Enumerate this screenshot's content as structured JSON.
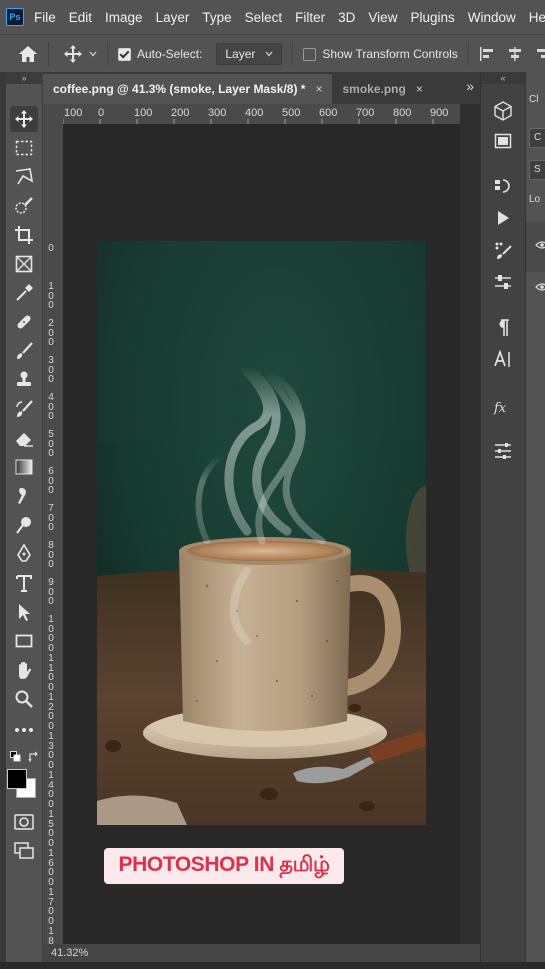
{
  "app": {
    "logo": "Ps"
  },
  "menu": {
    "items": [
      "File",
      "Edit",
      "Image",
      "Layer",
      "Type",
      "Select",
      "Filter",
      "3D",
      "View",
      "Plugins",
      "Window",
      "Help"
    ]
  },
  "options": {
    "auto_select_label": "Auto-Select:",
    "auto_select_checked": true,
    "auto_select_target": "Layer",
    "transform_controls_label": "Show Transform Controls",
    "transform_controls_checked": false
  },
  "tabs": [
    {
      "title": "coffee.png @ 41.3% (smoke, Layer Mask/8) *",
      "close": "×",
      "active": true
    },
    {
      "title": "smoke.png",
      "close": "×",
      "active": false
    }
  ],
  "tabs_more": "»",
  "ruler": {
    "horizontal": [
      "100",
      "0",
      "100",
      "200",
      "300",
      "400",
      "500",
      "600",
      "700",
      "800",
      "900"
    ],
    "vertical": [
      "0",
      "1 0 0",
      "2 0 0",
      "3 0 0",
      "4 0 0",
      "5 0 0",
      "6 0 0",
      "7 0 0",
      "8 0 0",
      "9 0 0",
      "1 0 0 0",
      "1 1 0 0",
      "1 2 0 0",
      "1 3 0 0",
      "1 4 0 0",
      "1 5 0 0",
      "1 6 0 0",
      "1 7 0 0",
      "1 8 0 0",
      "1 9 0 0"
    ]
  },
  "status": {
    "zoom": "41.32%"
  },
  "caption": "PHOTOSHOP IN தமிழ்",
  "right_panel": {
    "partial_labels": [
      "Cl",
      "C",
      "S",
      "Lo"
    ]
  },
  "colors": {
    "foreground": "#000000",
    "background": "#ffffff",
    "accent": "#31a8ff",
    "caption_text": "#e0304b",
    "caption_bg": "#fbe9ec"
  }
}
